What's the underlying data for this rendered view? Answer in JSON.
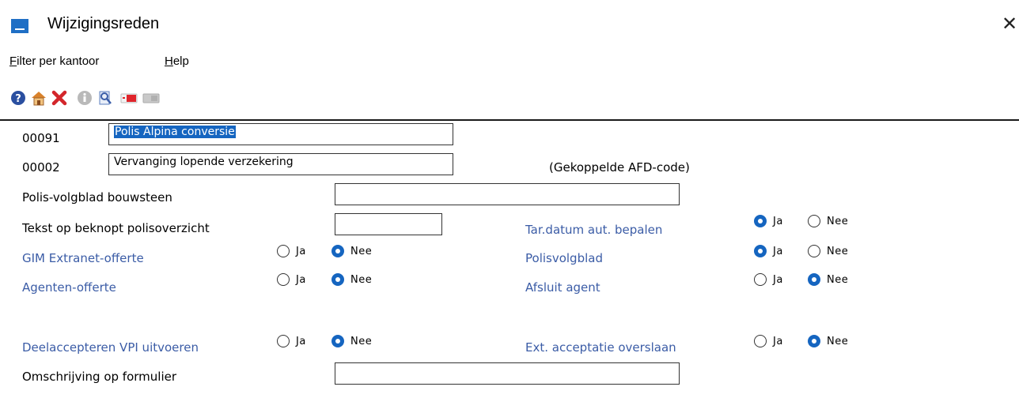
{
  "window": {
    "title": "Wijzigingsreden",
    "close_glyph": "✕",
    "app_icon": "app-logo-icon"
  },
  "menu": [
    {
      "accel": "F",
      "rest": "ilter per kantoor"
    },
    {
      "accel": "H",
      "rest": "elp"
    }
  ],
  "toolbar": {
    "icons": [
      "help-icon",
      "home-icon",
      "delete-icon",
      "info-icon",
      "search-document-icon",
      "card-red-icon",
      "card-grey-icon"
    ]
  },
  "form": {
    "row1": {
      "code": "00091",
      "value": "Polis Alpina conversie"
    },
    "row2": {
      "code": "00002",
      "value": "Vervanging lopende verzekering",
      "note": "(Gekoppelde AFD-code)"
    },
    "polis_volgblad_bouwsteen": {
      "label": "Polis-volgblad bouwsteen",
      "value": ""
    },
    "tekst_beknopt": {
      "label": "Tekst op beknopt polisoverzicht",
      "value": ""
    },
    "omschrijving": {
      "label": "Omschrijving op formulier",
      "value": ""
    },
    "yes_label": "Ja",
    "no_label": "Nee",
    "radios": {
      "gim_extranet": {
        "label": "GIM Extranet-offerte",
        "selected": "Nee"
      },
      "agenten_offerte": {
        "label": "Agenten-offerte",
        "selected": "Nee"
      },
      "deelaccepteren": {
        "label": "Deelaccepteren VPI uitvoeren",
        "selected": "Nee"
      },
      "tar_datum": {
        "label": "Tar.datum aut. bepalen",
        "selected": "Ja"
      },
      "polisvolgblad": {
        "label": "Polisvolgblad",
        "selected": "Ja"
      },
      "afsluit_agent": {
        "label": "Afsluit agent",
        "selected": "Nee"
      },
      "ext_acceptatie": {
        "label": "Ext. acceptatie overslaan",
        "selected": "Nee"
      }
    }
  },
  "colors": {
    "accent": "#1565c0",
    "link_label": "#3b5ca6"
  }
}
